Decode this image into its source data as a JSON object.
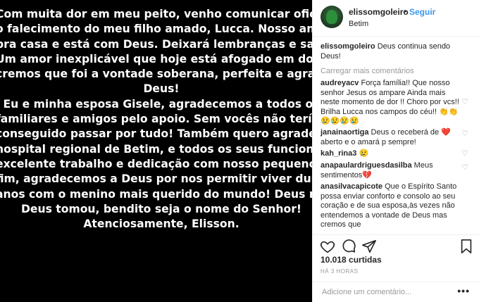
{
  "photo": {
    "text": "Com muita dor em meu peito, venho comunicar oficialme\no falecimento do meu filho amado, Lucca. Nosso anjo volt\npra casa e está com Deus. Deixará lembranças e saudad\nUm amor inexplicável que hoje está afogado em dor. Ma\ncremos que foi a vontade soberana, perfeita e agradável\nDeus!\nEu e minha esposa Gisele, agradecemos a todos os\nfamiliares e amigos pelo apoio. Sem vocês não teríamos\nconseguido passar por tudo! Também quero agradecer\nhospital regional de Betim, e todos os seus funcionários p\nexcelente trabalho e dedicação com nosso pequeno. E p\nfim, agradecemos a Deus por nos permitir viver durante\nanos com o menino mais querido do mundo! Deus me de\nDeus tomou, bendito seja o nome do Senhor!\nAtenciosamente, Elisson."
  },
  "header": {
    "username": "elissomgoleiro",
    "separator": "•",
    "follow_label": "Seguir",
    "location": "Betim"
  },
  "caption": {
    "username": "elissomgoleiro",
    "text": "Deus continua sendo Deus!"
  },
  "load_more_label": "Carregar mais comentários",
  "comments": [
    {
      "username": "audreyacv",
      "text": "Força família!! Que nosso senhor Jesus os ampare Ainda mais neste momento de dor !! Choro por vcs!! Brilha Lucca nos campos do céu!! ",
      "emoji": "👏👏😢😢😢😢"
    },
    {
      "username": "janainaortiga",
      "text": "Deus o receberá de ",
      "emoji": "❤️",
      "text2": " aberto e o amará p sempre!"
    },
    {
      "username": "kah_rina3",
      "text": "",
      "emoji": "😢"
    },
    {
      "username": "anapaulardriguesdasilba",
      "text": "Meus sentimentos",
      "emoji": "💔"
    },
    {
      "username": "anasilvacapicote",
      "text": "Que o Espírito Santo possa enviar conforto e consolo ao seu coração e de sua esposa,às vezes não entendemos a vontade de Deus mas cremos que",
      "emoji": ""
    }
  ],
  "likes": "10.018 curtidas",
  "time": "HÁ 3 HORAS",
  "add_comment_placeholder": "Adicione um comentário...",
  "more_label": "•••",
  "heart_glyph": "♡"
}
